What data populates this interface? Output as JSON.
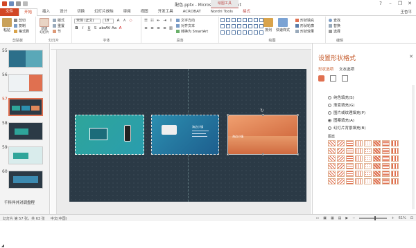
{
  "window": {
    "title": "配色.pptx - Microsoft PowerPoint",
    "context_tab_header": "绘图工具",
    "user": "王杏平"
  },
  "tabs": [
    {
      "label": "文件"
    },
    {
      "label": "开始"
    },
    {
      "label": "插入"
    },
    {
      "label": "设计"
    },
    {
      "label": "切换"
    },
    {
      "label": "幻灯片放映"
    },
    {
      "label": "审阅"
    },
    {
      "label": "视图"
    },
    {
      "label": "开发工具"
    },
    {
      "label": "ACROBAT"
    },
    {
      "label": "Nordri Tools"
    },
    {
      "label": "格式"
    }
  ],
  "ribbon": {
    "paste": "粘贴",
    "cut": "剪切",
    "copy": "复制",
    "format_painter": "格式刷",
    "clipboard_label": "剪贴板",
    "new_slide": "新建\n幻灯片",
    "layout": "版式",
    "reset": "重置",
    "section": "节",
    "slides_label": "幻灯片",
    "font_name": "宋体 (正文)",
    "font_size": "18",
    "font_label": "字体",
    "para_label": "段落",
    "text_direction": "文字方向",
    "align_text": "对齐文本",
    "smartart": "转换为 SmartArt",
    "drawing_label": "绘图",
    "arrange": "排列",
    "quick_styles": "快速样式",
    "shape_fill": "形状填充",
    "shape_outline": "形状轮廓",
    "shape_effects": "形状效果",
    "find": "查找",
    "replace": "替换",
    "select": "选择",
    "edit_label": "编辑"
  },
  "thumbnails": [
    {
      "num": "55",
      "selected": false,
      "color": "#2c6f8a"
    },
    {
      "num": "56",
      "selected": false,
      "color": "#e8eef2"
    },
    {
      "num": "57",
      "selected": true,
      "color": "#2b3a46"
    },
    {
      "num": "58",
      "selected": false,
      "color": "#2b3a46"
    },
    {
      "num": "59",
      "selected": false,
      "color": "#d9ecec"
    },
    {
      "num": "60",
      "selected": false,
      "color": "#2b3a46"
    }
  ],
  "section_label": "千科伴并对调盘程",
  "slide": {
    "card2_text": "海边小镇",
    "card3_text": "海边小镇"
  },
  "format_pane": {
    "title": "设置形状格式",
    "tab_shape": "形状选项",
    "tab_text": "文本选项",
    "fill_options": [
      {
        "label": "纯色填充(S)",
        "checked": false
      },
      {
        "label": "渐变填充(G)",
        "checked": false
      },
      {
        "label": "图片或纹理填充(P)",
        "checked": false
      },
      {
        "label": "图案填充(A)",
        "checked": true
      },
      {
        "label": "幻灯片背景填充(B)",
        "checked": false
      }
    ],
    "pattern_label": "图案"
  },
  "status": {
    "slide_info": "幻灯片 第 57 张，共 63 张",
    "language": "中文(中国)",
    "zoom": "61%"
  },
  "colors": {
    "accent": "#d24726",
    "slide_bg": "#2b3a46",
    "pane_title": "#c55a2a"
  }
}
